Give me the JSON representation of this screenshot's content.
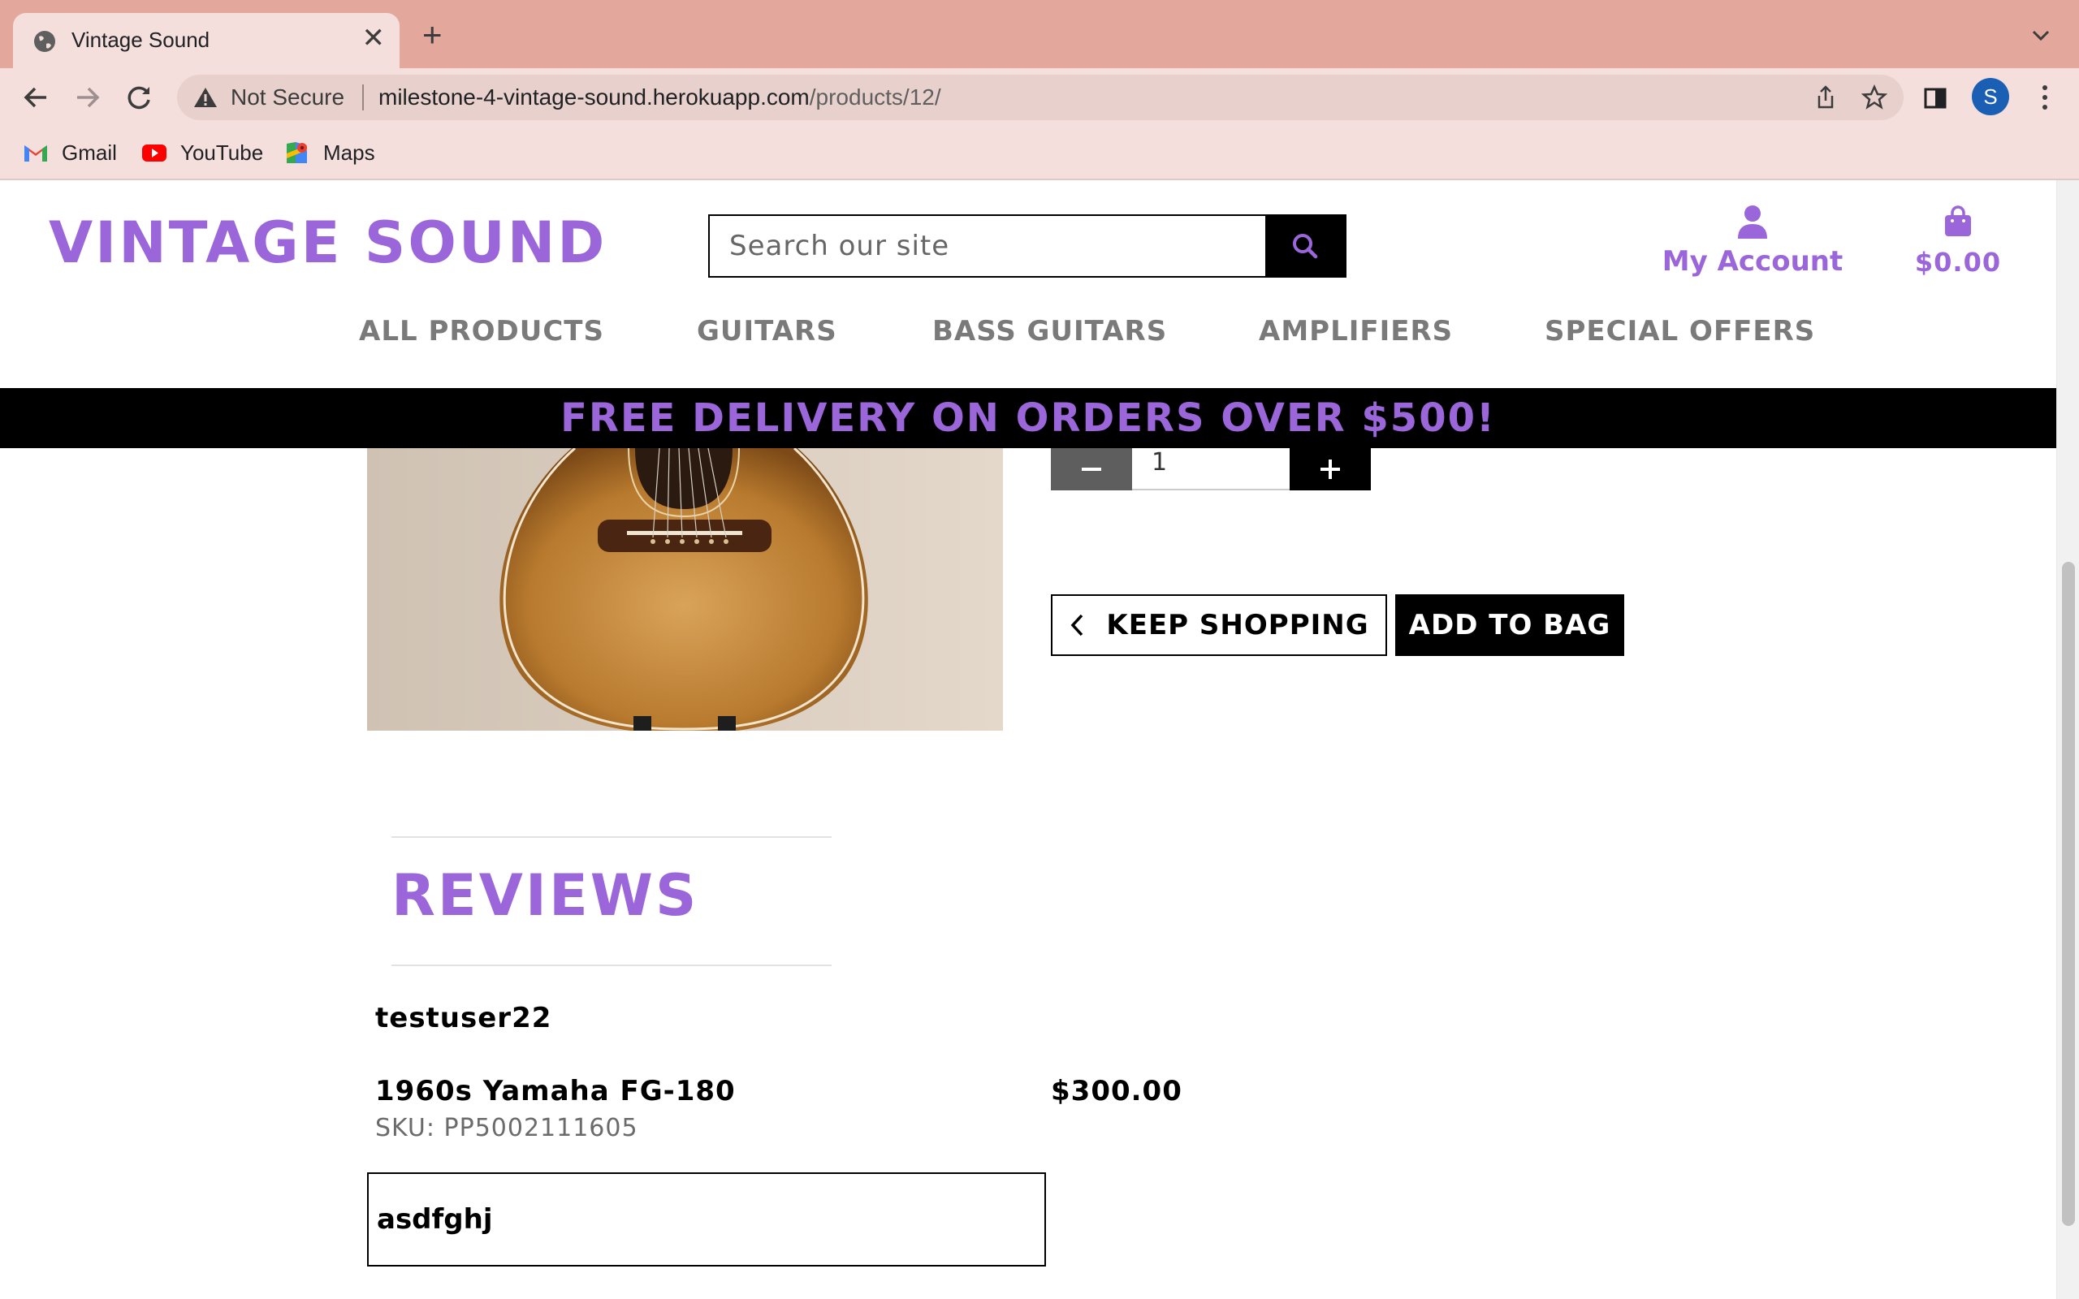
{
  "browser": {
    "tab_title": "Vintage Sound",
    "tab_close": "✕",
    "new_tab": "+",
    "security_label": "Not Secure",
    "url_host": "milestone-4-vintage-sound.herokuapp.com",
    "url_path": "/products/12/",
    "profile_initial": "S",
    "bookmarks": [
      {
        "label": "Gmail",
        "icon": "gmail-icon"
      },
      {
        "label": "YouTube",
        "icon": "youtube-icon"
      },
      {
        "label": "Maps",
        "icon": "maps-icon"
      }
    ]
  },
  "site": {
    "logo": "VINTAGE SOUND",
    "search_placeholder": "Search our site",
    "account_label": "My Account",
    "bag_total": "$0.00",
    "nav": [
      "ALL PRODUCTS",
      "GUITARS",
      "BASS GUITARS",
      "AMPLIFIERS",
      "SPECIAL OFFERS"
    ],
    "banner": "FREE DELIVERY ON ORDERS OVER $500!",
    "brand_color": "#9b66d9"
  },
  "product": {
    "quantity": "1",
    "keep_shopping_label": "KEEP SHOPPING",
    "add_to_bag_label": "ADD TO BAG"
  },
  "reviews": {
    "title": "REVIEWS",
    "items": [
      {
        "username": "testuser22",
        "product_name": "1960s Yamaha FG-180",
        "sku": "SKU: PP5002111605",
        "price": "$300.00",
        "body": "asdfghj"
      }
    ]
  }
}
